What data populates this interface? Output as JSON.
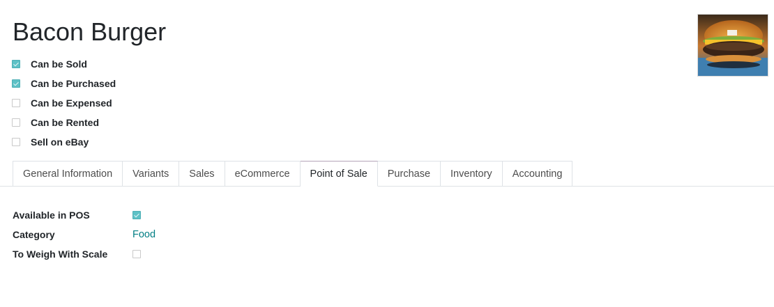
{
  "product": {
    "title": "Bacon Burger",
    "image": "burger-photo"
  },
  "options": [
    {
      "label": "Can be Sold",
      "checked": true
    },
    {
      "label": "Can be Purchased",
      "checked": true
    },
    {
      "label": "Can be Expensed",
      "checked": false
    },
    {
      "label": "Can be Rented",
      "checked": false
    },
    {
      "label": "Sell on eBay",
      "checked": false
    }
  ],
  "tabs": [
    {
      "label": "General Information",
      "active": false
    },
    {
      "label": "Variants",
      "active": false
    },
    {
      "label": "Sales",
      "active": false
    },
    {
      "label": "eCommerce",
      "active": false
    },
    {
      "label": "Point of Sale",
      "active": true
    },
    {
      "label": "Purchase",
      "active": false
    },
    {
      "label": "Inventory",
      "active": false
    },
    {
      "label": "Accounting",
      "active": false
    }
  ],
  "pos": {
    "available_label": "Available in POS",
    "available_checked": true,
    "category_label": "Category",
    "category_value": "Food",
    "weigh_label": "To Weigh With Scale",
    "weigh_checked": false
  },
  "colors": {
    "checkbox_checked": "#5ec1c6",
    "link": "#017e84",
    "border": "#dee2e6"
  }
}
